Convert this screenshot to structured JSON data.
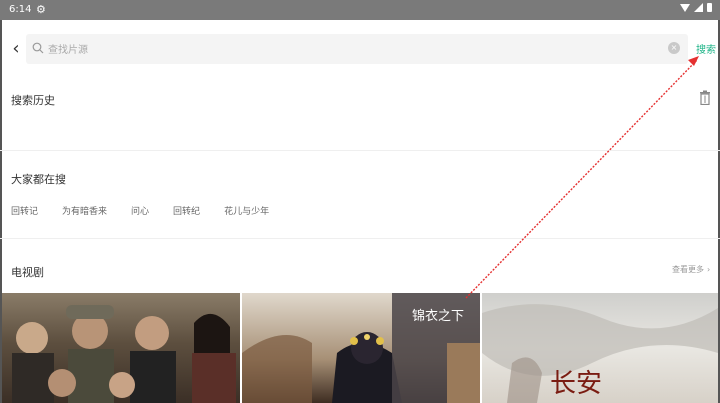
{
  "status_bar": {
    "time": "6:14"
  },
  "search": {
    "placeholder": "查找片源",
    "button_label": "搜索"
  },
  "history": {
    "title": "搜索历史"
  },
  "trending": {
    "title": "大家都在搜",
    "tags": [
      "回转记",
      "为有暗香来",
      "问心",
      "回转纪",
      "花儿与少年"
    ]
  },
  "tv": {
    "title": "电视剧",
    "more_label": "查看更多",
    "posters": [
      {
        "title": ""
      },
      {
        "title": "锦衣之下"
      },
      {
        "title": "长安"
      }
    ]
  },
  "colors": {
    "accent": "#1fb488",
    "annotation": "#e53030",
    "status_bar": "#7a7a7a"
  }
}
